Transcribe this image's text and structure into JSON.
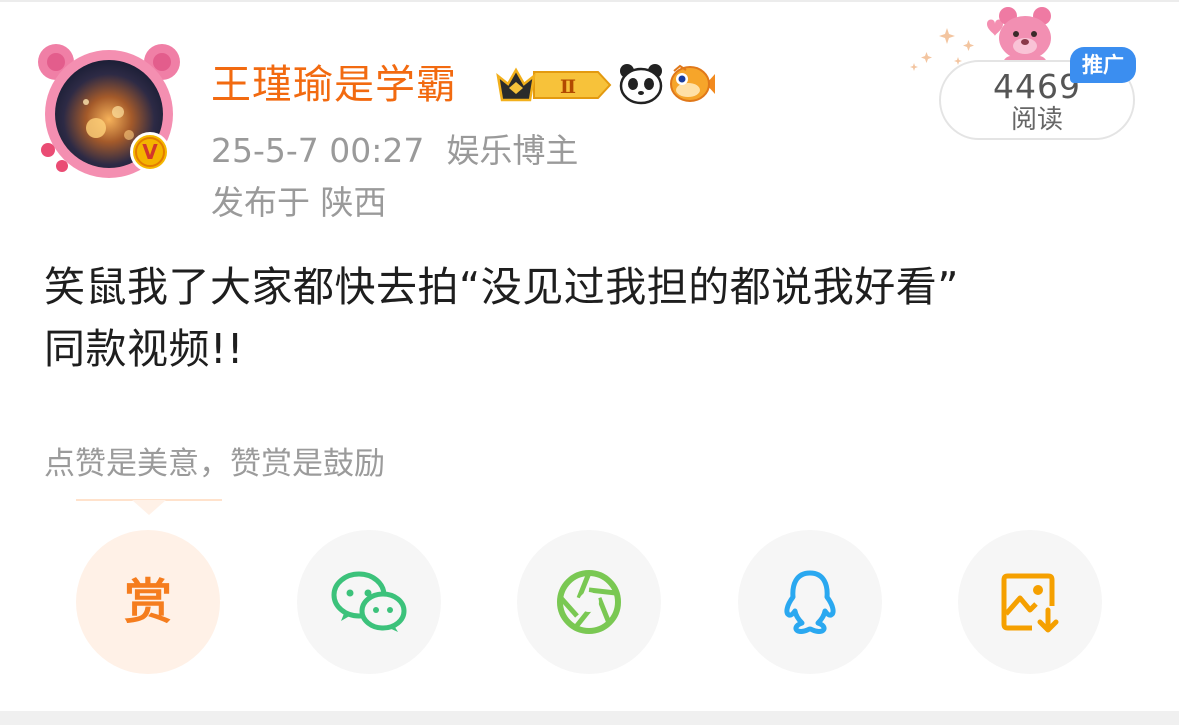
{
  "user": {
    "name": "王瑾瑜是学霸",
    "vip_level": "Ⅱ",
    "verified_mark": "V"
  },
  "post": {
    "date": "25-5-7 00:27",
    "category": "娱乐博主",
    "location": "发布于 陕西",
    "text_lines": [
      "笑鼠我了大家都快去拍“没见过我担的都说我好看”",
      "同款视频!!"
    ]
  },
  "stats": {
    "read_count": "4469",
    "read_label": "阅读",
    "promo_tag": "推广"
  },
  "reward": {
    "tip": "点赞是美意，赞赏是鼓励",
    "button_label": "赏"
  },
  "actions": {
    "icons": [
      "reward-icon",
      "wechat-icon",
      "moments-icon",
      "qq-icon",
      "save-image-icon"
    ]
  },
  "colors": {
    "username": "#f26a10",
    "reward_accent": "#f57d1e",
    "wechat": "#3cc27b",
    "moments": "#7ac853",
    "qq": "#2aa8f0",
    "save_image": "#f5a000",
    "promo": "#3b8ef0"
  }
}
